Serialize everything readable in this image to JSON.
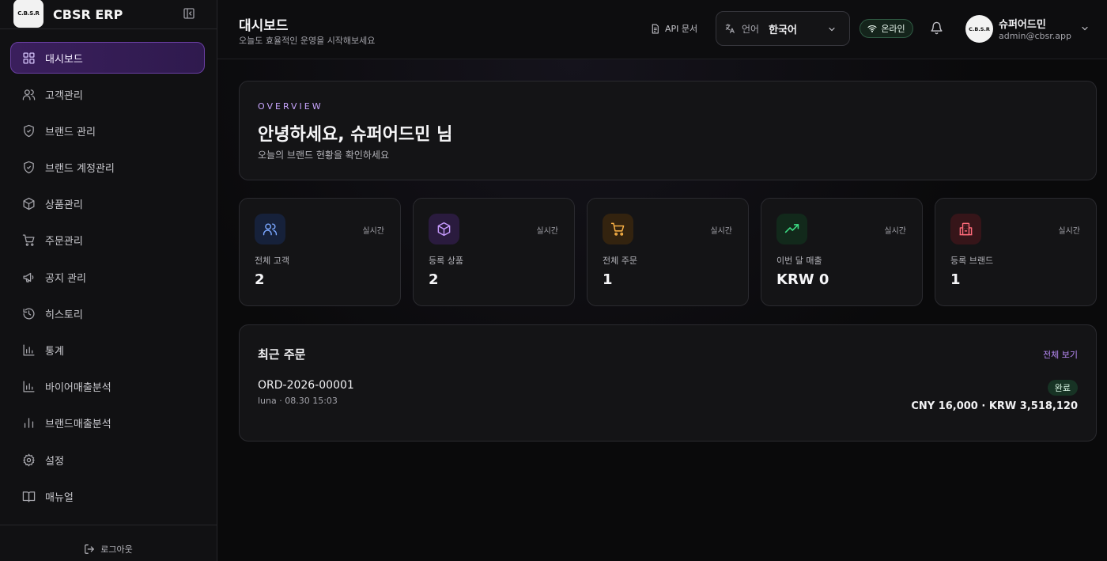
{
  "brand": {
    "logo_text": "C.B.S.R",
    "name": "CBSR ERP"
  },
  "sidebar": {
    "items": [
      {
        "label": "대시보드",
        "icon": "dashboard-icon",
        "active": true
      },
      {
        "label": "고객관리",
        "icon": "users-icon"
      },
      {
        "label": "브랜드 관리",
        "icon": "shield-icon"
      },
      {
        "label": "브랜드 계정관리",
        "icon": "shield-icon"
      },
      {
        "label": "상품관리",
        "icon": "package-icon"
      },
      {
        "label": "주문관리",
        "icon": "cart-icon"
      },
      {
        "label": "공지 관리",
        "icon": "megaphone-icon"
      },
      {
        "label": "히스토리",
        "icon": "history-icon"
      },
      {
        "label": "통계",
        "icon": "bar-chart-icon"
      },
      {
        "label": "바이어매출분석",
        "icon": "bar-chart-icon"
      },
      {
        "label": "브랜드매출분석",
        "icon": "bar-chart-icon"
      },
      {
        "label": "설정",
        "icon": "gear-icon"
      },
      {
        "label": "매뉴얼",
        "icon": "book-icon"
      }
    ],
    "logout_label": "로그아웃"
  },
  "header": {
    "title": "대시보드",
    "subtitle": "오늘도 효율적인 운영을 시작해보세요",
    "api_docs_label": "API 문서",
    "language_label": "언어",
    "language_value": "한국어",
    "online_label": "온라인",
    "user": {
      "avatar_text": "C.B.S.R",
      "name": "슈퍼어드민",
      "email": "admin@cbsr.app"
    }
  },
  "overview": {
    "kicker": "OVERVIEW",
    "title": "안녕하세요, 슈퍼어드민 님",
    "subtitle": "오늘의 브랜드 현황을 확인하세요"
  },
  "stats": [
    {
      "label": "전체 고객",
      "value": "2",
      "badge": "실시간",
      "icon": "users-icon",
      "color": "#7aa7ff",
      "bg": "#16213a"
    },
    {
      "label": "등록 상품",
      "value": "2",
      "badge": "실시간",
      "icon": "package-icon",
      "color": "#c79bff",
      "bg": "#2a1b3e"
    },
    {
      "label": "전체 주문",
      "value": "1",
      "badge": "실시간",
      "icon": "cart-icon",
      "color": "#ffb547",
      "bg": "#33230f"
    },
    {
      "label": "이번 달 매출",
      "value": "KRW 0",
      "badge": "실시간",
      "icon": "trend-up-icon",
      "color": "#3ddc84",
      "bg": "#12291b"
    },
    {
      "label": "등록 브랜드",
      "value": "1",
      "badge": "실시간",
      "icon": "building-icon",
      "color": "#ff6b7a",
      "bg": "#361519"
    }
  ],
  "recent_orders": {
    "title": "최근 주문",
    "view_all_label": "전체 보기",
    "rows": [
      {
        "id": "ORD-2026-00001",
        "meta": "luna · 08.30 15:03",
        "status": "완료",
        "amount": "CNY 16,000 · KRW 3,518,120"
      }
    ]
  }
}
